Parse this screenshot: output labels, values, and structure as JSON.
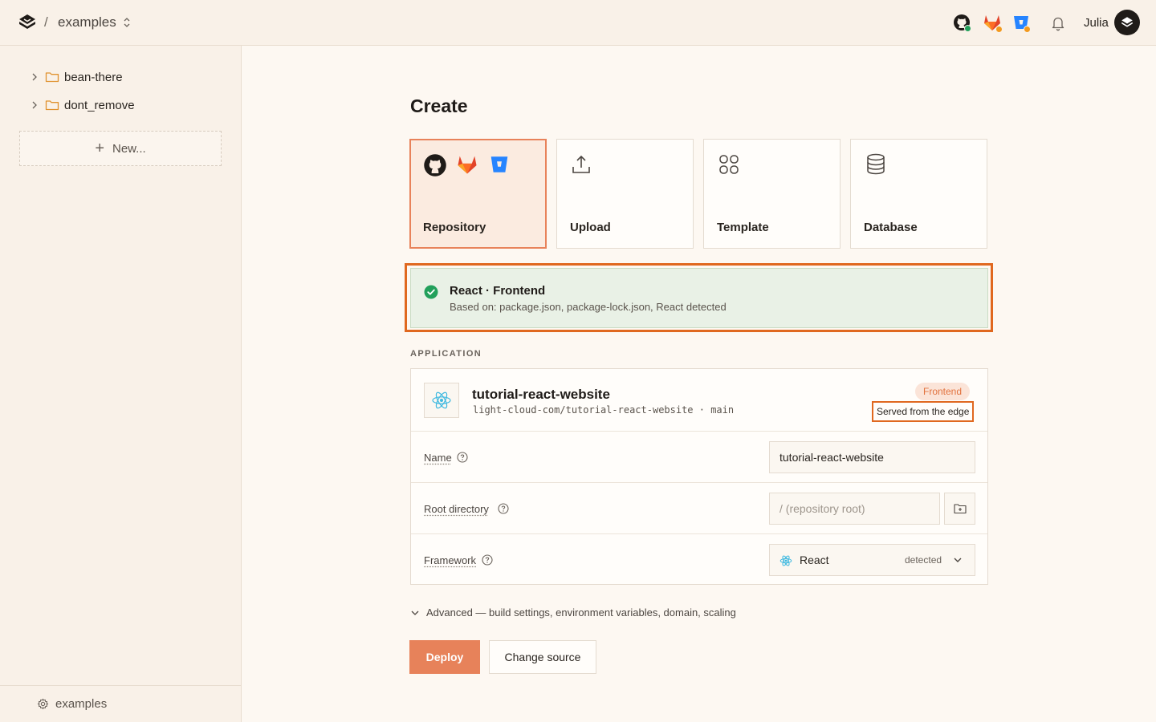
{
  "header": {
    "separator": "/",
    "project": "examples",
    "user": "Julia"
  },
  "sidebar": {
    "items": [
      {
        "label": "bean-there"
      },
      {
        "label": "dont_remove"
      }
    ],
    "new_label": "New...",
    "footer_label": "examples"
  },
  "main": {
    "title": "Create",
    "sources": [
      {
        "label": "Repository"
      },
      {
        "label": "Upload"
      },
      {
        "label": "Template"
      },
      {
        "label": "Database"
      }
    ],
    "detection": {
      "title": "React · Frontend",
      "subtitle": "Based on: package.json, package-lock.json, React detected"
    },
    "section_label": "APPLICATION",
    "app": {
      "name": "tutorial-react-website",
      "repo": "light-cloud-com/tutorial-react-website · main",
      "badge": "Frontend",
      "note": "Served from the edge"
    },
    "fields": {
      "name_label": "Name",
      "name_value": "tutorial-react-website",
      "root_label": "Root directory",
      "root_placeholder": "/ (repository root)",
      "framework_label": "Framework",
      "framework_value": "React",
      "framework_hint": "detected"
    },
    "advanced_label": "Advanced — build settings, environment variables, domain, scaling",
    "deploy_label": "Deploy",
    "change_label": "Change source"
  },
  "colors": {
    "accent": "#e7825a",
    "highlight": "#e0681f",
    "success": "#22a05b"
  }
}
